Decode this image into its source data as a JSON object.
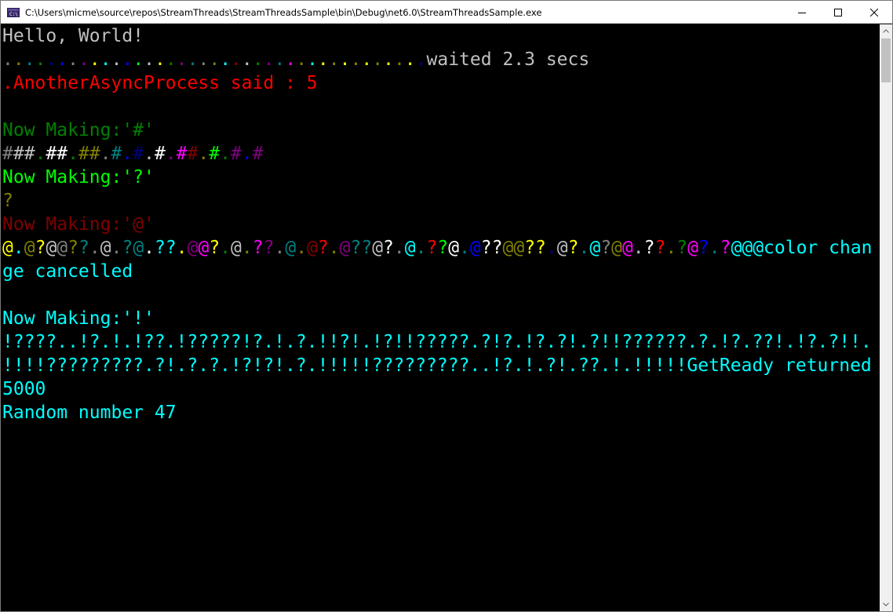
{
  "window": {
    "title": "C:\\Users\\micme\\source\\repos\\StreamThreads\\StreamThreadsSample\\bin\\Debug\\net6.0\\StreamThreadsSample.exe",
    "app_icon": "console-app-icon",
    "buttons": {
      "minimize": "minimize-icon",
      "maximize": "maximize-icon",
      "close": "close-icon"
    }
  },
  "colors": {
    "background": "#000000",
    "gray": "#c0c0c0",
    "darkgray": "#808080",
    "white": "#ffffff",
    "red": "#ff0000",
    "darkred": "#800000",
    "green": "#00ff00",
    "darkgreen": "#008000",
    "yellow": "#ffff00",
    "darkyellow": "#808000",
    "blue": "#0000ff",
    "darkblue": "#000080",
    "cyan": "#00ffff",
    "darkcyan": "#008080",
    "magenta": "#ff00ff",
    "darkmagenta": "#800080"
  },
  "console_lines": [
    {
      "segments": [
        {
          "text": "Hello, World!",
          "color": "#c0c0c0"
        }
      ]
    },
    {
      "segments": [
        {
          "text": ".",
          "color": "#808080"
        },
        {
          "text": ".",
          "color": "#808000"
        },
        {
          "text": ".",
          "color": "#008080"
        },
        {
          "text": ".",
          "color": "#008000"
        },
        {
          "text": ".",
          "color": "#000080"
        },
        {
          "text": ".",
          "color": "#0000ff"
        },
        {
          "text": ".",
          "color": "#808080"
        },
        {
          "text": ".",
          "color": "#800080"
        },
        {
          "text": ".",
          "color": "#ffff00"
        },
        {
          "text": ".",
          "color": "#00ffff"
        },
        {
          "text": ".",
          "color": "#c0c0c0"
        },
        {
          "text": ".",
          "color": "#0000ff"
        },
        {
          "text": ".",
          "color": "#00ff00"
        },
        {
          "text": ".",
          "color": "#c0c0c0"
        },
        {
          "text": ".",
          "color": "#ffff00"
        },
        {
          "text": ".",
          "color": "#008000"
        },
        {
          "text": ".",
          "color": "#800080"
        },
        {
          "text": ".",
          "color": "#008080"
        },
        {
          "text": ".",
          "color": "#808080"
        },
        {
          "text": ".",
          "color": "#808000"
        },
        {
          "text": ".",
          "color": "#00ffff"
        },
        {
          "text": ".",
          "color": "#800000"
        },
        {
          "text": ".",
          "color": "#c0c0c0"
        },
        {
          "text": ".",
          "color": "#008000"
        },
        {
          "text": ".",
          "color": "#800080"
        },
        {
          "text": ".",
          "color": "#008080"
        },
        {
          "text": ".",
          "color": "#ff00ff"
        },
        {
          "text": ".",
          "color": "#808000"
        },
        {
          "text": ".",
          "color": "#00ffff"
        },
        {
          "text": ".",
          "color": "#ffff00"
        },
        {
          "text": ".",
          "color": "#808000"
        },
        {
          "text": ".",
          "color": "#ffff00"
        },
        {
          "text": ".",
          "color": "#808000"
        },
        {
          "text": ".",
          "color": "#ffff00"
        },
        {
          "text": ".",
          "color": "#808000"
        },
        {
          "text": ".",
          "color": "#ffff00"
        },
        {
          "text": ".",
          "color": "#808000"
        },
        {
          "text": ".",
          "color": "#ffff00"
        },
        {
          "text": ".",
          "color": "#000080"
        },
        {
          "text": "waited 2.3 secs",
          "color": "#c0c0c0"
        }
      ]
    },
    {
      "segments": [
        {
          "text": ".AnotherAsyncProcess said : 5",
          "color": "#ff0000"
        }
      ]
    },
    {
      "segments": []
    },
    {
      "segments": [
        {
          "text": "Now Making:'#'",
          "color": "#008000"
        }
      ]
    },
    {
      "segments": [
        {
          "text": "#",
          "color": "#808080"
        },
        {
          "text": "##",
          "color": "#c0c0c0"
        },
        {
          "text": ".",
          "color": "#008000"
        },
        {
          "text": "##",
          "color": "#ffffff"
        },
        {
          "text": ".",
          "color": "#008000"
        },
        {
          "text": "##",
          "color": "#808000"
        },
        {
          "text": ".",
          "color": "#808080"
        },
        {
          "text": "#",
          "color": "#008080"
        },
        {
          "text": ".",
          "color": "#0000ff"
        },
        {
          "text": "#",
          "color": "#000080"
        },
        {
          "text": ".",
          "color": "#c0c0c0"
        },
        {
          "text": "#",
          "color": "#ffffff"
        },
        {
          "text": ".",
          "color": "#800080"
        },
        {
          "text": "#",
          "color": "#ff00ff"
        },
        {
          "text": "#",
          "color": "#800000"
        },
        {
          "text": ".",
          "color": "#808000"
        },
        {
          "text": "#",
          "color": "#00ff00"
        },
        {
          "text": ".",
          "color": "#008000"
        },
        {
          "text": "#",
          "color": "#800080"
        },
        {
          "text": ".",
          "color": "#0000ff"
        },
        {
          "text": "#",
          "color": "#800080"
        }
      ]
    },
    {
      "segments": [
        {
          "text": "Now Making:'?'",
          "color": "#00ff00"
        }
      ]
    },
    {
      "segments": [
        {
          "text": "?",
          "color": "#808000"
        }
      ]
    },
    {
      "segments": [
        {
          "text": "Now Making:'@'",
          "color": "#800000"
        }
      ]
    },
    {
      "segments": [
        {
          "text": "@",
          "color": "#ffff00"
        },
        {
          "text": ".",
          "color": "#00ffff"
        },
        {
          "text": "@",
          "color": "#808000"
        },
        {
          "text": "?",
          "color": "#ffff00"
        },
        {
          "text": "@",
          "color": "#c0c0c0"
        },
        {
          "text": "@",
          "color": "#808080"
        },
        {
          "text": "?",
          "color": "#808000"
        },
        {
          "text": "?",
          "color": "#008080"
        },
        {
          "text": ".",
          "color": "#808080"
        },
        {
          "text": "@",
          "color": "#c0c0c0"
        },
        {
          "text": ".",
          "color": "#808080"
        },
        {
          "text": "?",
          "color": "#008080"
        },
        {
          "text": "@",
          "color": "#008080"
        },
        {
          "text": ".",
          "color": "#ffffff"
        },
        {
          "text": "??",
          "color": "#00ffff"
        },
        {
          "text": ".",
          "color": "#ffff00"
        },
        {
          "text": "@",
          "color": "#800080"
        },
        {
          "text": "@",
          "color": "#ff00ff"
        },
        {
          "text": "?",
          "color": "#ffff00"
        },
        {
          "text": ".",
          "color": "#008000"
        },
        {
          "text": "@",
          "color": "#c0c0c0"
        },
        {
          "text": ".",
          "color": "#808000"
        },
        {
          "text": "?",
          "color": "#ff00ff"
        },
        {
          "text": "?",
          "color": "#800080"
        },
        {
          "text": ".",
          "color": "#808080"
        },
        {
          "text": "@",
          "color": "#008080"
        },
        {
          "text": ".",
          "color": "#808000"
        },
        {
          "text": "@",
          "color": "#800000"
        },
        {
          "text": "?",
          "color": "#ff0000"
        },
        {
          "text": ".",
          "color": "#808000"
        },
        {
          "text": "@",
          "color": "#800080"
        },
        {
          "text": "??",
          "color": "#008080"
        },
        {
          "text": "@",
          "color": "#c0c0c0"
        },
        {
          "text": "?",
          "color": "#ffffff"
        },
        {
          "text": ".",
          "color": "#808080"
        },
        {
          "text": "@",
          "color": "#00ffff"
        },
        {
          "text": ".",
          "color": "#008080"
        },
        {
          "text": "?",
          "color": "#ff0000"
        },
        {
          "text": "?",
          "color": "#00ff00"
        },
        {
          "text": "@",
          "color": "#ffffff"
        },
        {
          "text": ".",
          "color": "#008080"
        },
        {
          "text": "@",
          "color": "#0000ff"
        },
        {
          "text": "??",
          "color": "#ffffff"
        },
        {
          "text": "@@",
          "color": "#808000"
        },
        {
          "text": "??",
          "color": "#ffff00"
        },
        {
          "text": ".",
          "color": "#000080"
        },
        {
          "text": "@",
          "color": "#c0c0c0"
        },
        {
          "text": "?",
          "color": "#ffff00"
        },
        {
          "text": ".",
          "color": "#008080"
        },
        {
          "text": "@",
          "color": "#00ffff"
        },
        {
          "text": "?",
          "color": "#808080"
        },
        {
          "text": "@",
          "color": "#808000"
        },
        {
          "text": "@",
          "color": "#ff00ff"
        },
        {
          "text": ".",
          "color": "#c0c0c0"
        },
        {
          "text": "?",
          "color": "#ffffff"
        },
        {
          "text": "?",
          "color": "#ff0000"
        },
        {
          "text": ".",
          "color": "#808000"
        },
        {
          "text": "?",
          "color": "#008000"
        },
        {
          "text": "@",
          "color": "#ff00ff"
        },
        {
          "text": "?",
          "color": "#0000ff"
        },
        {
          "text": ".",
          "color": "#008080"
        },
        {
          "text": "?",
          "color": "#ff00ff"
        },
        {
          "text": "@@@color chan",
          "color": "#00ffff"
        }
      ]
    },
    {
      "segments": [
        {
          "text": "ge cancelled",
          "color": "#00ffff"
        }
      ]
    },
    {
      "segments": []
    },
    {
      "segments": [
        {
          "text": "Now Making:'!'",
          "color": "#00ffff"
        }
      ]
    },
    {
      "segments": [
        {
          "text": "!????..!?.!.!??.!?????!?.!.?.!!?!.!?!!?????.?!?.!?.?!.?!!??????.?.!?.??!.!?.?!!.",
          "color": "#00ffff"
        }
      ]
    },
    {
      "segments": [
        {
          "text": "!!!!?????????.?!.?.?.!?!?!.?.!!!!!?????????..!?.!.?!.??.!.!!!!!GetReady returned",
          "color": "#00ffff"
        }
      ]
    },
    {
      "segments": [
        {
          "text": "5000",
          "color": "#00ffff"
        }
      ]
    },
    {
      "segments": [
        {
          "text": "Random number 47",
          "color": "#00ffff"
        }
      ]
    }
  ]
}
